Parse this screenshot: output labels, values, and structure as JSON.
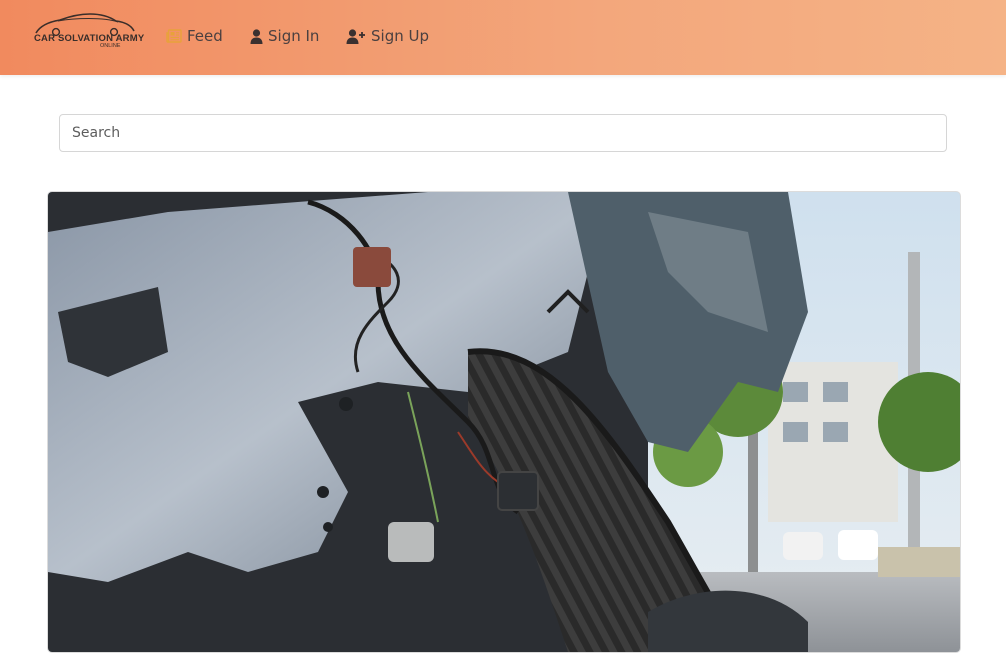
{
  "navbar": {
    "brand": {
      "name": "CAR SOLVATION ARMY",
      "sub": "ONLINE",
      "icon": "car-logo-icon"
    },
    "links": [
      {
        "label": "Feed",
        "icon": "newspaper-icon"
      },
      {
        "label": "Sign In",
        "icon": "user-icon"
      },
      {
        "label": "Sign Up",
        "icon": "user-plus-icon"
      }
    ],
    "colors": {
      "gradient_start": "#f18a5e",
      "gradient_end": "#f5b386",
      "text": "#4b4040",
      "feed_icon": "#e8a23a"
    }
  },
  "search": {
    "placeholder": "Search",
    "value": ""
  },
  "feed": {
    "cards": [
      {
        "image": "wrecked-car-tire-photo"
      }
    ]
  }
}
